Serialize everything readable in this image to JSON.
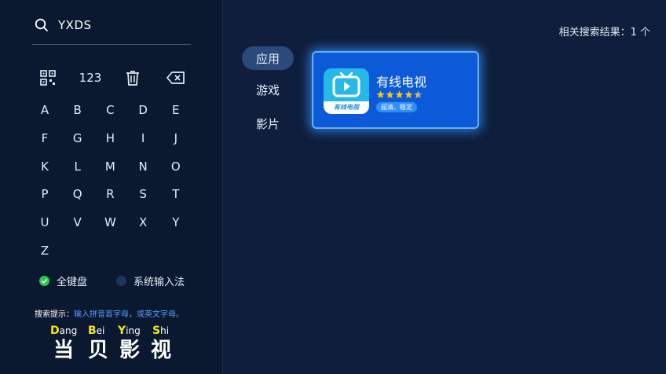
{
  "search": {
    "query": "YXDS"
  },
  "tools": {
    "qr_icon": "qr-code-icon",
    "numeric_label": "123",
    "delete_icon": "trash-icon",
    "backspace_icon": "backspace-icon"
  },
  "keys": [
    "A",
    "B",
    "C",
    "D",
    "E",
    "F",
    "G",
    "H",
    "I",
    "J",
    "K",
    "L",
    "M",
    "N",
    "O",
    "P",
    "Q",
    "R",
    "S",
    "T",
    "U",
    "V",
    "W",
    "X",
    "Y",
    "Z"
  ],
  "keyboard_options": {
    "full_keyboard": "全键盘",
    "system_input": "系统输入法",
    "selected": "full_keyboard"
  },
  "tip": {
    "label": "搜索提示：",
    "text": "输入拼音首字母，或英文字母。"
  },
  "brand": [
    {
      "initial": "D",
      "rest": "ang",
      "hanzi": "当"
    },
    {
      "initial": "B",
      "rest": "ei",
      "hanzi": "贝"
    },
    {
      "initial": "Y",
      "rest": "ing",
      "hanzi": "影"
    },
    {
      "initial": "S",
      "rest": "hi",
      "hanzi": "视"
    }
  ],
  "result_count": "相关搜索结果：1 个",
  "categories": [
    {
      "label": "应用",
      "active": true
    },
    {
      "label": "游戏",
      "active": false
    },
    {
      "label": "影片",
      "active": false
    }
  ],
  "result": {
    "app_name": "有线电视",
    "icon_caption": "有线电视",
    "rating": 4.5,
    "rating_max": 5,
    "tag": "超清、稳定"
  },
  "colors": {
    "background": "#0e1e3c",
    "panel": "#0a1830",
    "card": "#0c5ad8",
    "card_glow": "#5fb0ff",
    "accent_green": "#2cc64a",
    "star": "#f5c518",
    "pinyin_initial": "#f4e31e",
    "tip_text": "#5b9bff"
  }
}
